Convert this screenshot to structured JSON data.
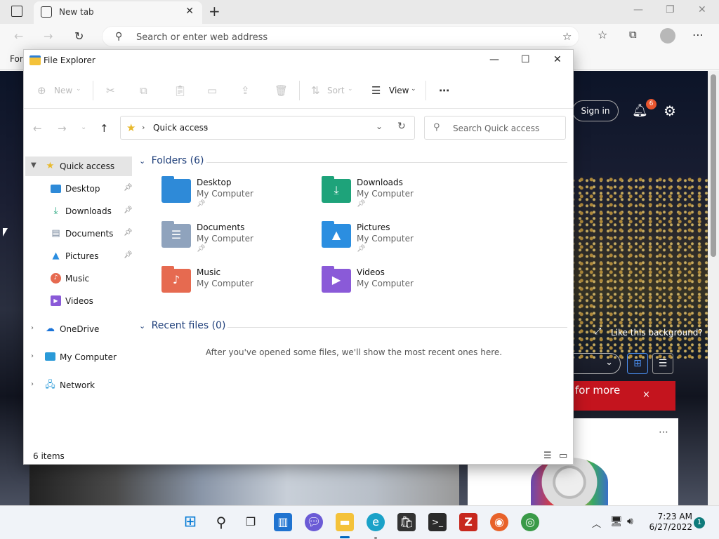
{
  "browser": {
    "tab_title": "New tab",
    "address_placeholder": "Search or enter web address",
    "favorites_text": "For"
  },
  "page": {
    "signin_label": "Sign in",
    "notification_count": "6",
    "like_background": "Like this background?",
    "red_banner_text": "for more",
    "red_banner_close": "×"
  },
  "explorer": {
    "title": "File Explorer",
    "toolbar": {
      "new_label": "New",
      "sort_label": "Sort",
      "view_label": "View"
    },
    "address_label": "Quick access",
    "search_placeholder": "Search Quick access",
    "nav": {
      "quick_access": "Quick access",
      "desktop": "Desktop",
      "downloads": "Downloads",
      "documents": "Documents",
      "pictures": "Pictures",
      "music": "Music",
      "videos": "Videos",
      "onedrive": "OneDrive",
      "my_computer": "My Computer",
      "network": "Network"
    },
    "folders_header": "Folders (6)",
    "folders": [
      {
        "name": "Desktop",
        "location": "My Computer",
        "color": "#2e8ad8"
      },
      {
        "name": "Downloads",
        "location": "My Computer",
        "color": "#1ea37a"
      },
      {
        "name": "Documents",
        "location": "My Computer",
        "color": "#8fa3bd"
      },
      {
        "name": "Pictures",
        "location": "My Computer",
        "color": "#2b8ee0"
      },
      {
        "name": "Music",
        "location": "My Computer",
        "color": "#e66a50"
      },
      {
        "name": "Videos",
        "location": "My Computer",
        "color": "#8a5ad8"
      }
    ],
    "recent_header": "Recent files (0)",
    "recent_empty": "After you've opened some files, we'll show the most recent ones here.",
    "status_count": "6 items"
  },
  "taskbar": {
    "time": "7:23 AM",
    "date": "6/27/2022",
    "notification_badge": "1"
  }
}
